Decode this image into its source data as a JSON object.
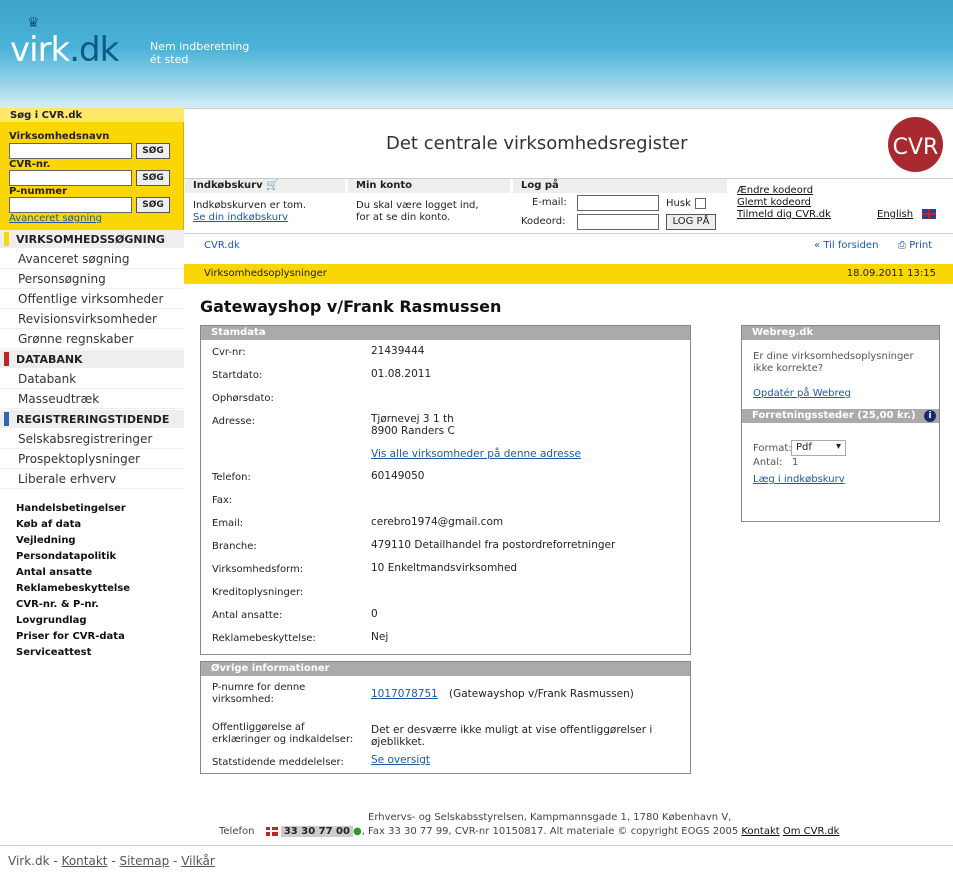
{
  "header": {
    "logo": "virk.dk",
    "logo_a": "virk",
    "logo_b": ".dk",
    "tagline1": "Nem indberetning",
    "tagline2": "ét sted"
  },
  "search": {
    "title": "Søg i CVR.dk",
    "name_label": "Virksomhedsnavn",
    "cvr_label": "CVR-nr.",
    "p_label": "P-nummer",
    "button": "SØG",
    "advanced": "Avanceret søgning"
  },
  "nav": {
    "sec1": "VIRKSOMHEDSSØGNING",
    "items1": [
      "Avanceret søgning",
      "Personsøgning",
      "Offentlige virksomheder",
      "Revisionsvirksomheder",
      "Grønne regnskaber"
    ],
    "sec2": "DATABANK",
    "items2": [
      "Databank",
      "Masseudtræk"
    ],
    "sec3": "REGISTRERINGSTIDENDE",
    "items3": [
      "Selskabsregistreringer",
      "Prospektoplysninger",
      "Liberale erhverv"
    ],
    "links": [
      "Handelsbetingelser",
      "Køb af data",
      "Vejledning",
      "Persondatapolitik",
      "Antal ansatte",
      "Reklamebeskyttelse",
      "CVR-nr. & P-nr.",
      "Lovgrundlag",
      "Priser for CVR-data",
      "Serviceattest"
    ]
  },
  "cvr": {
    "title": "Det centrale virksomhedsregister",
    "logo": "CVR"
  },
  "toolbar": {
    "cart_title": "Indkøbskurv",
    "cart_text": "Indkøbskurven er tom.",
    "cart_link": "Se din indkøbskurv",
    "account_title": "Min konto",
    "account_text1": "Du skal være logget ind,",
    "account_text2": "for at se din konto.",
    "login_title": "Log på",
    "email_label": "E-mail:",
    "code_label": "Kodeord:",
    "remember": "Husk",
    "login_btn": "LOG PÅ",
    "change_code": "Ændre kodeord",
    "forgot": "Glemt kodeord",
    "signup": "Tilmeld dig CVR.dk",
    "english": "English"
  },
  "breadcrumb": "CVR.dk",
  "to_front": "Til forsiden",
  "print": "Print",
  "bar": {
    "label": "Virksomhedsoplysninger",
    "datetime": "18.09.2011 13:15"
  },
  "company": {
    "name": "Gatewayshop v/Frank Rasmussen"
  },
  "stamdata": {
    "title": "Stamdata",
    "rows": [
      {
        "label": "Cvr-nr:",
        "value": "21439444"
      },
      {
        "label": "Startdato:",
        "value": "01.08.2011"
      },
      {
        "label": "Ophørsdato:",
        "value": ""
      },
      {
        "label": "Adresse:",
        "value": "Tjørnevej 3 1 th",
        "value2": "8900 Randers C",
        "link": "Vis alle virksomheder på denne adresse"
      },
      {
        "label": "Telefon:",
        "value": "60149050"
      },
      {
        "label": "Fax:",
        "value": ""
      },
      {
        "label": "Email:",
        "value": "cerebro1974@gmail.com"
      },
      {
        "label": "Branche:",
        "value": "479110 Detailhandel fra postordreforretninger"
      },
      {
        "label": "Virksomhedsform:",
        "value": "10 Enkeltmandsvirksomhed"
      },
      {
        "label": "Kreditoplysninger:",
        "value": ""
      },
      {
        "label": "Antal ansatte:",
        "value": "0"
      },
      {
        "label": "Reklamebeskyttelse:",
        "value": "Nej"
      }
    ]
  },
  "other": {
    "title": "Øvrige informationer",
    "p_label1": "P-numre for denne",
    "p_label2": "virksomhed:",
    "p_link": "1017078751",
    "p_text": "(Gatewayshop v/Frank Rasmussen)",
    "pub_label1": "Offentliggørelse af",
    "pub_label2": "erklæringer og indkaldelser:",
    "pub_text1": "Det er desværre ikke muligt at vise offentliggørelser i",
    "pub_text2": "øjeblikket.",
    "stat_label": "Statstidende meddelelser:",
    "stat_link": "Se oversigt"
  },
  "webreg": {
    "title": "Webreg.dk",
    "text1": "Er dine virksomhedsoplysninger",
    "text2": "ikke korrekte?",
    "link": "Opdatér på Webreg",
    "title2": "Forretningssteder (25,00 kr.)",
    "format_label": "Format:",
    "format_value": "Pdf",
    "count_label": "Antal:",
    "count_value": "1",
    "cart_link": "Læg i indkøbskurv"
  },
  "footer": {
    "line1": "Erhvervs- og Selskabsstyrelsen, Kampmannsgade 1, 1780 København V,",
    "phone_label": "Telefon",
    "phone": "33 30 77 00",
    "line2": ", Fax 33 30 77 99, CVR-nr 10150817. Alt materiale © copyright EOGS 2005",
    "contact": "Kontakt",
    "about": "Om CVR.dk"
  },
  "bottom": {
    "site": "Virk.dk",
    "sep": "-",
    "contact": "Kontakt",
    "sitemap": "Sitemap",
    "terms": "Vilkår"
  }
}
